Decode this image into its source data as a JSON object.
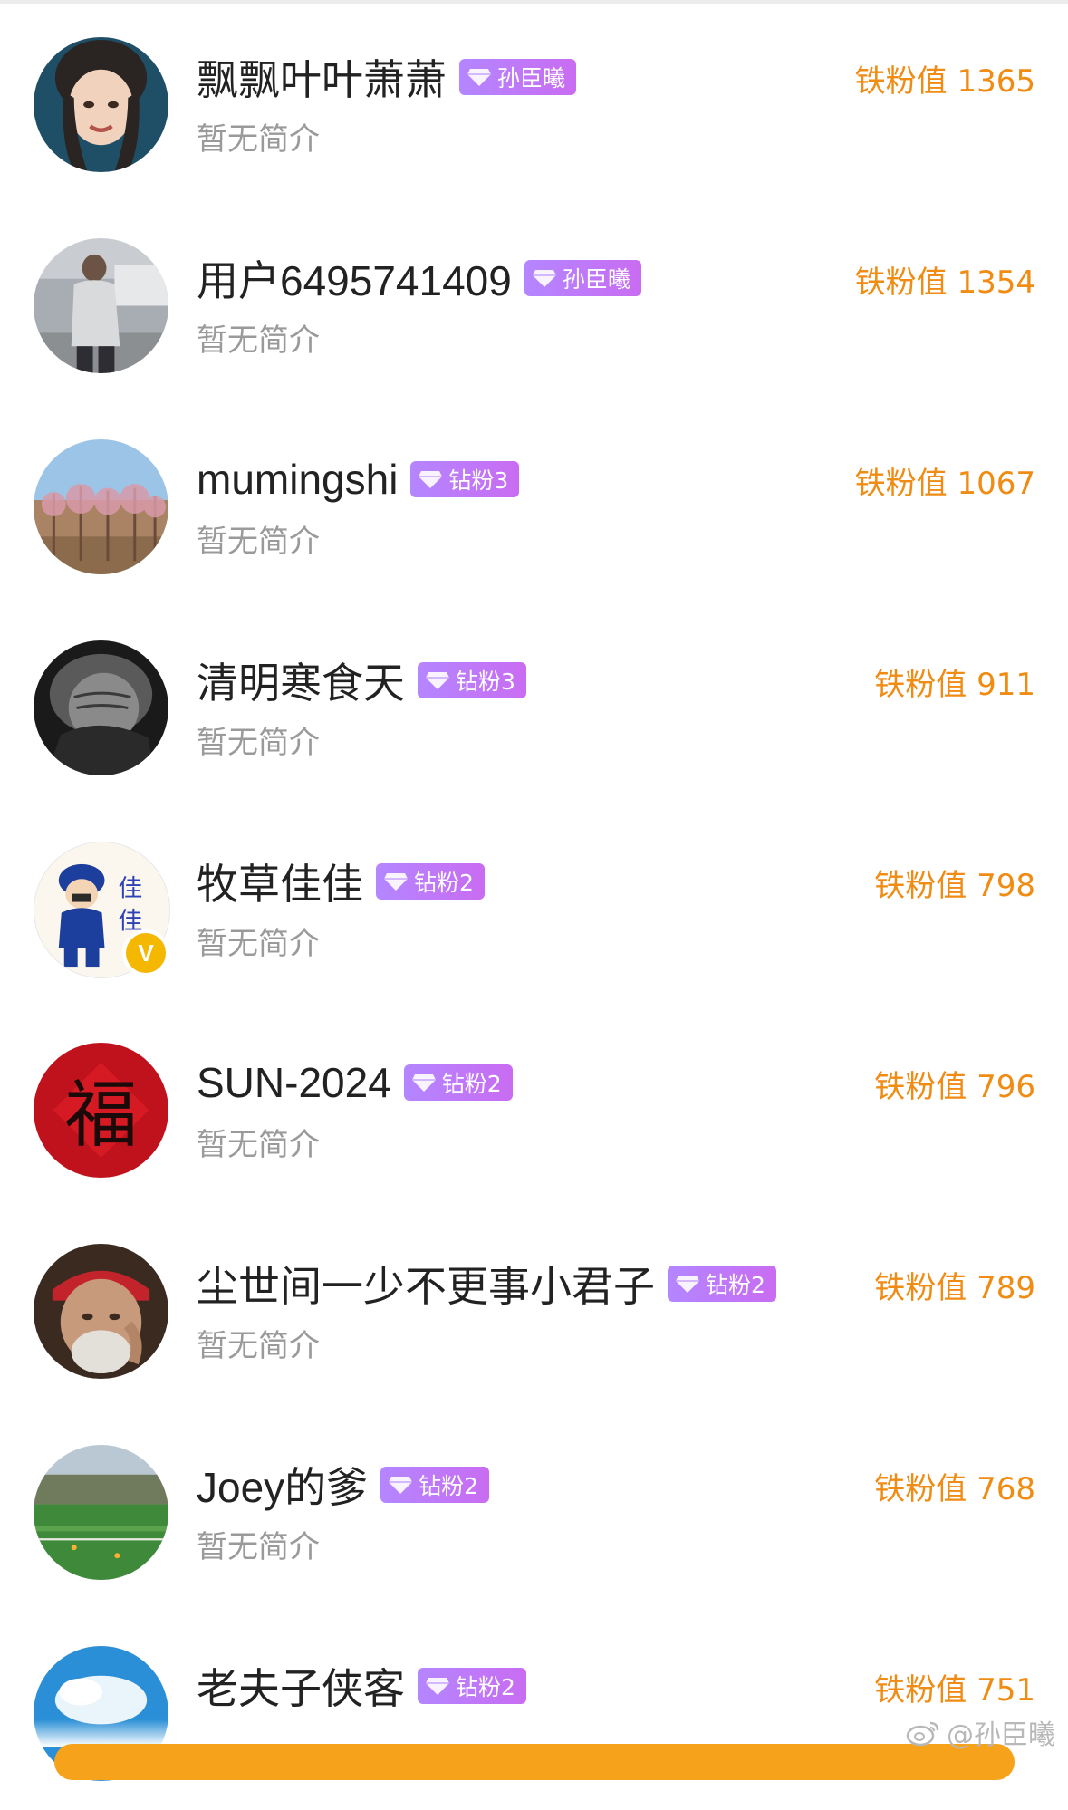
{
  "fans": [
    {
      "name": "飘飘叶叶萧萧",
      "badge": "孙臣曦",
      "bio": "暂无简介",
      "score": "铁粉值 1365",
      "avatar": "portrait-girl",
      "verified": false
    },
    {
      "name": "用户6495741409",
      "badge": "孙臣曦",
      "bio": "暂无简介",
      "score": "铁粉值 1354",
      "avatar": "man-in-jacket",
      "verified": false
    },
    {
      "name": "mumingshi",
      "badge": "钻粉3",
      "bio": "暂无简介",
      "score": "铁粉值 1067",
      "avatar": "blossom-orchard",
      "verified": false
    },
    {
      "name": "清明寒食天",
      "badge": "钻粉3",
      "bio": "暂无简介",
      "score": "铁粉值 911",
      "avatar": "old-woman-bw",
      "verified": false
    },
    {
      "name": "牧草佳佳",
      "badge": "钻粉2",
      "bio": "暂无简介",
      "score": "铁粉值 798",
      "avatar": "cartoon-boy",
      "verified": true,
      "verified_mark": "V"
    },
    {
      "name": "SUN-2024",
      "badge": "钻粉2",
      "bio": "暂无简介",
      "score": "铁粉值 796",
      "avatar": "fu-character",
      "verified": false
    },
    {
      "name": "尘世间一少不更事小君子",
      "badge": "钻粉2",
      "bio": "暂无简介",
      "score": "铁粉值 789",
      "avatar": "old-man-bandana",
      "verified": false
    },
    {
      "name": "Joey的爹",
      "badge": "钻粉2",
      "bio": "暂无简介",
      "score": "铁粉值 768",
      "avatar": "soccer-field",
      "verified": false
    },
    {
      "name": "老夫子侠客",
      "badge": "钻粉2",
      "bio": "",
      "score": "铁粉值 751",
      "avatar": "blue-sky",
      "verified": false
    }
  ],
  "watermark": "@孙臣曦",
  "colors": {
    "score": "#f08c14",
    "badge": "#b486ff",
    "bio": "#9a9a9a",
    "name": "#222222",
    "bottom_bar": "#f7a21b"
  }
}
